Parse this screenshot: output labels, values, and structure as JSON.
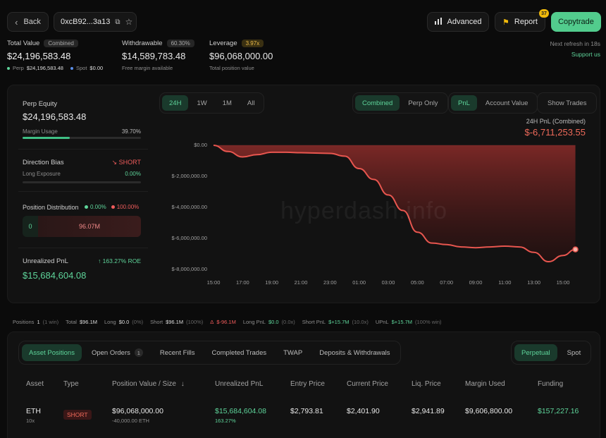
{
  "header": {
    "back_label": "Back",
    "address": "0xcB92...3a13",
    "advanced_label": "Advanced",
    "report_label": "Report",
    "report_badge": "37",
    "copytrade_label": "Copytrade",
    "next_refresh": "Next refresh in 18s",
    "support": "Support us"
  },
  "summary": {
    "total_value_label": "Total Value",
    "total_value_pill": "Combined",
    "total_value": "$24,196,583.48",
    "perp_label": "Perp",
    "perp_value": "$24,196,583.48",
    "spot_label": "Spot",
    "spot_value": "$0.00",
    "withdrawable_label": "Withdrawable",
    "withdrawable_pill": "60.30%",
    "withdrawable_value": "$14,589,783.48",
    "withdrawable_sub": "Free margin available",
    "leverage_label": "Leverage",
    "leverage_pill": "3.97x",
    "leverage_value": "$96,068,000.00",
    "leverage_sub": "Total position value"
  },
  "left_panel": {
    "perp_equity_label": "Perp Equity",
    "perp_equity_value": "$24,196,583.48",
    "margin_usage_label": "Margin Usage",
    "margin_usage_value": "39.70%",
    "margin_usage_fraction": 0.397,
    "direction_bias_label": "Direction Bias",
    "direction_bias_value": "SHORT",
    "long_exposure_label": "Long Exposure",
    "long_exposure_value": "0.00%",
    "position_dist_label": "Position Distribution",
    "position_dist_long": "0.00%",
    "position_dist_short": "100.00%",
    "dist_long_amount": "0",
    "dist_short_amount": "96.07M",
    "unrealized_label": "Unrealized PnL",
    "roe": "163.27% ROE",
    "unrealized_value": "$15,684,604.08"
  },
  "chart_controls": {
    "ranges": [
      "24H",
      "1W",
      "1M",
      "All"
    ],
    "active_range": "24H",
    "modes": [
      "Combined",
      "Perp Only"
    ],
    "active_mode": "Combined",
    "metrics": [
      "PnL",
      "Account Value"
    ],
    "active_metric": "PnL",
    "show_trades": "Show Trades",
    "pnl_title": "24H PnL (Combined)",
    "pnl_value": "$-6,711,253.55",
    "watermark": "hyperdash.info"
  },
  "chart_data": {
    "type": "area",
    "x": [
      "15:00",
      "16:00",
      "17:00",
      "18:00",
      "19:00",
      "20:00",
      "21:00",
      "22:00",
      "23:00",
      "00:00",
      "01:00",
      "02:00",
      "03:00",
      "04:00",
      "05:00",
      "06:00",
      "07:00",
      "08:00",
      "09:00",
      "10:00",
      "11:00",
      "12:00",
      "13:00",
      "14:00",
      "15:00",
      "15:40"
    ],
    "y": [
      0,
      -400000,
      -750000,
      -600000,
      -450000,
      -450000,
      -480000,
      -500000,
      -520000,
      -700000,
      -1500000,
      -2200000,
      -3200000,
      -4200000,
      -5600000,
      -6300000,
      -6400000,
      -6550000,
      -6600000,
      -6550000,
      -6500000,
      -6550000,
      -6900000,
      -7500000,
      -7100000,
      -6711253.55
    ],
    "xticks": [
      "15:00",
      "17:00",
      "19:00",
      "21:00",
      "23:00",
      "01:00",
      "03:00",
      "05:00",
      "07:00",
      "09:00",
      "11:00",
      "13:00",
      "15:00"
    ],
    "yticks": [
      "$0.00",
      "$-2,000,000.00",
      "$-4,000,000.00",
      "$-6,000,000.00",
      "$-8,000,000.00"
    ],
    "ylim": [
      -8000000,
      0
    ],
    "line_color": "#e8564f"
  },
  "stats_strip": {
    "positions_label": "Positions",
    "positions_value": "1",
    "positions_sub": "(1 win)",
    "total_label": "Total",
    "total_value": "$96.1M",
    "long_label": "Long",
    "long_value": "$0.0",
    "long_pct": "(0%)",
    "short_label": "Short",
    "short_value": "$96.1M",
    "short_pct": "(100%)",
    "delta_symbol": "Δ",
    "delta_value": "$-96.1M",
    "long_pnl_label": "Long PnL",
    "long_pnl_value": "$0.0",
    "long_pnl_sub": "(0.0x)",
    "short_pnl_label": "Short PnL",
    "short_pnl_value": "$+15.7M",
    "short_pnl_sub": "(10.0x)",
    "upnl_label": "UPnL",
    "upnl_value": "$+15.7M",
    "upnl_sub": "(100% win)"
  },
  "tabs": {
    "items": [
      "Asset Positions",
      "Open Orders",
      "Recent Fills",
      "Completed Trades",
      "TWAP",
      "Deposits & Withdrawals"
    ],
    "open_orders_count": "1",
    "active": "Asset Positions",
    "market_toggle": [
      "Perpetual",
      "Spot"
    ],
    "market_active": "Perpetual"
  },
  "table": {
    "headers": [
      "Asset",
      "Type",
      "Position Value / Size",
      "Unrealized PnL",
      "Entry Price",
      "Current Price",
      "Liq. Price",
      "Margin Used",
      "Funding"
    ],
    "row": {
      "asset": "ETH",
      "leverage": "10x",
      "type": "SHORT",
      "position_value": "$96,068,000.00",
      "position_size": "-40,000.00 ETH",
      "upnl": "$15,684,604.08",
      "upnl_pct": "163.27%",
      "entry": "$2,793.81",
      "current": "$2,401.90",
      "liq": "$2,941.89",
      "margin": "$9,606,800.00",
      "funding": "$157,227.16"
    }
  }
}
